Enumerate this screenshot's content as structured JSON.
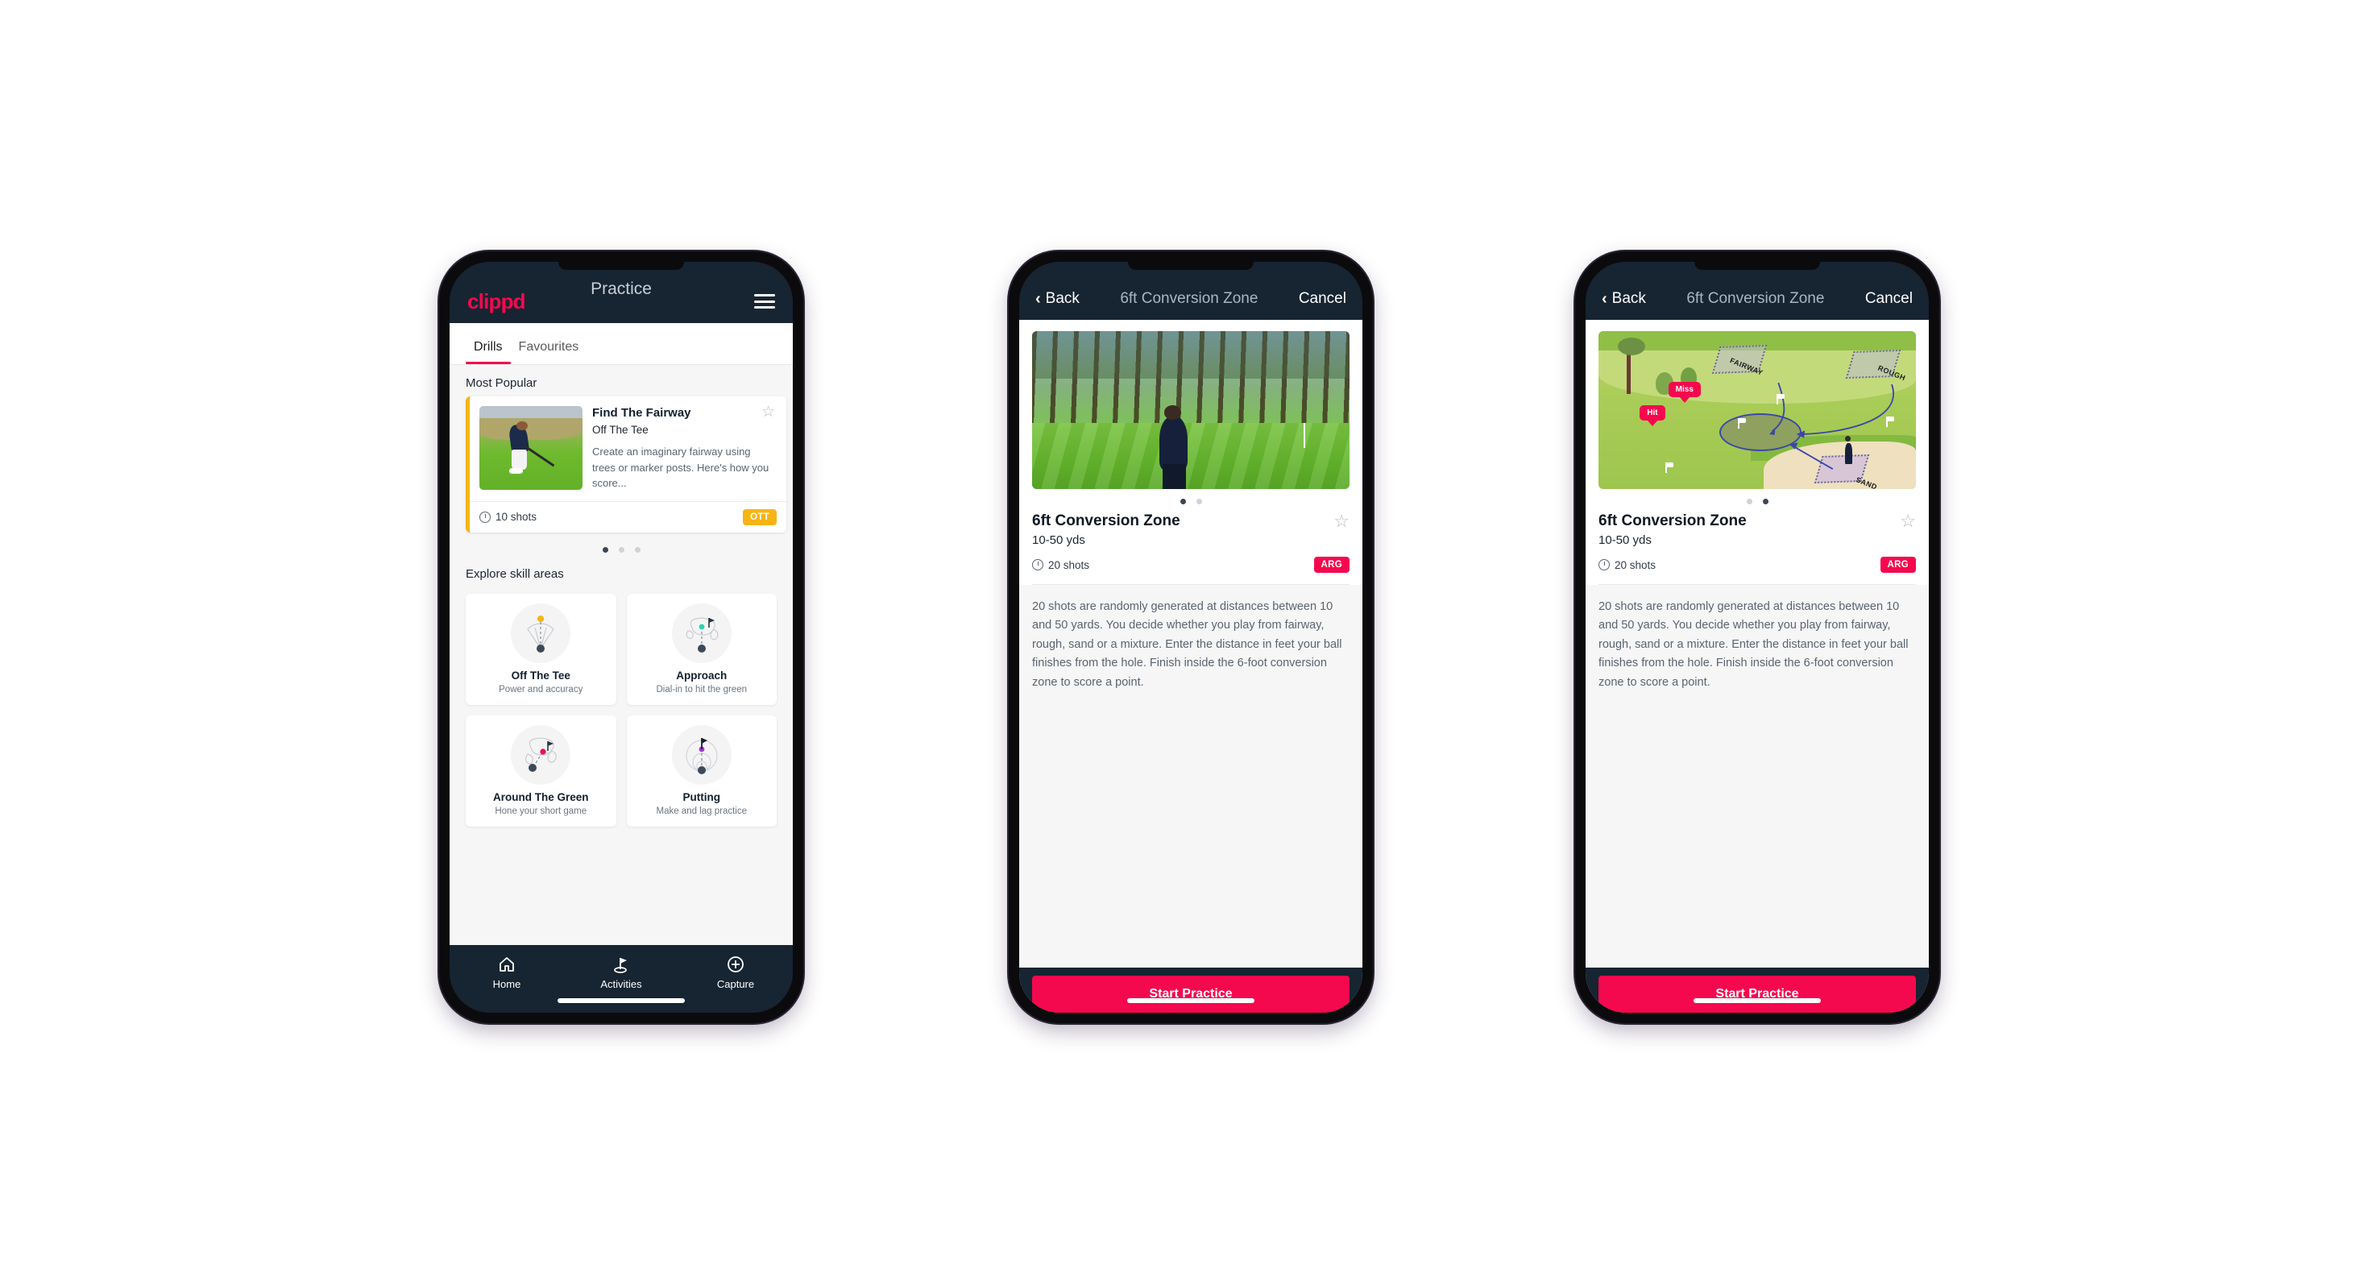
{
  "phone1": {
    "navbar": {
      "brand": "clippd",
      "title": "Practice",
      "menu_icon": "hamburger-icon"
    },
    "tabs": [
      {
        "label": "Drills",
        "active": true
      },
      {
        "label": "Favourites",
        "active": false
      }
    ],
    "sections": {
      "most_popular": "Most Popular",
      "explore": "Explore skill areas"
    },
    "featured_drill": {
      "title": "Find The Fairway",
      "category": "Off The Tee",
      "description": "Create an imaginary fairway using trees or marker posts. Here's how you score...",
      "shots": "10 shots",
      "chip": "OTT",
      "chip_color": "#f6b415",
      "accent_color": "#f6b415",
      "star_icon": "star-outline-icon"
    },
    "carousel_dots": 3,
    "carousel_active": 0,
    "skill_areas": [
      {
        "name": "Off The Tee",
        "desc": "Power and accuracy",
        "icon": "tee-fan-icon",
        "dot_color": "#f6b415"
      },
      {
        "name": "Approach",
        "desc": "Dial-in to hit the green",
        "icon": "approach-green-icon",
        "dot_color": "#2ed3b0"
      },
      {
        "name": "Around The Green",
        "desc": "Hone your short game",
        "icon": "chip-green-icon",
        "dot_color": "#f5094e"
      },
      {
        "name": "Putting",
        "desc": "Make and lag practice",
        "icon": "putting-rings-icon",
        "dot_color": "#a435d6"
      }
    ],
    "bottom_nav": [
      {
        "label": "Home",
        "icon": "home-icon",
        "active": false
      },
      {
        "label": "Activities",
        "icon": "golf-flag-icon",
        "active": true
      },
      {
        "label": "Capture",
        "icon": "plus-circle-icon",
        "active": false
      }
    ]
  },
  "phone2": {
    "navbar": {
      "back": "Back",
      "title": "6ft Conversion Zone",
      "cancel": "Cancel",
      "back_icon": "chevron-left-icon"
    },
    "hero": "golfer-pine-forest-photo",
    "carousel_dots": 2,
    "carousel_active": 0,
    "detail": {
      "title": "6ft Conversion Zone",
      "yards": "10-50 yds",
      "shots": "20 shots",
      "chip": "ARG",
      "chip_color": "#f5094e",
      "star_icon": "star-outline-icon",
      "description": "20 shots are randomly generated at distances between 10 and 50 yards. You decide whether you play from fairway, rough, sand or a mixture. Enter the distance in feet your ball finishes from the hole. Finish inside the 6-foot conversion zone to score a point."
    },
    "cta": "Start Practice"
  },
  "phone3": {
    "navbar": {
      "back": "Back",
      "title": "6ft Conversion Zone",
      "cancel": "Cancel",
      "back_icon": "chevron-left-icon"
    },
    "hero": "course-diagram-illustration",
    "diagram": {
      "zones": [
        "FAIRWAY",
        "ROUGH",
        "SAND"
      ],
      "markers": [
        "Miss",
        "Hit"
      ]
    },
    "carousel_dots": 2,
    "carousel_active": 1,
    "detail": {
      "title": "6ft Conversion Zone",
      "yards": "10-50 yds",
      "shots": "20 shots",
      "chip": "ARG",
      "chip_color": "#f5094e",
      "star_icon": "star-outline-icon",
      "description": "20 shots are randomly generated at distances between 10 and 50 yards. You decide whether you play from fairway, rough, sand or a mixture. Enter the distance in feet your ball finishes from the hole. Finish inside the 6-foot conversion zone to score a point."
    },
    "cta": "Start Practice"
  }
}
